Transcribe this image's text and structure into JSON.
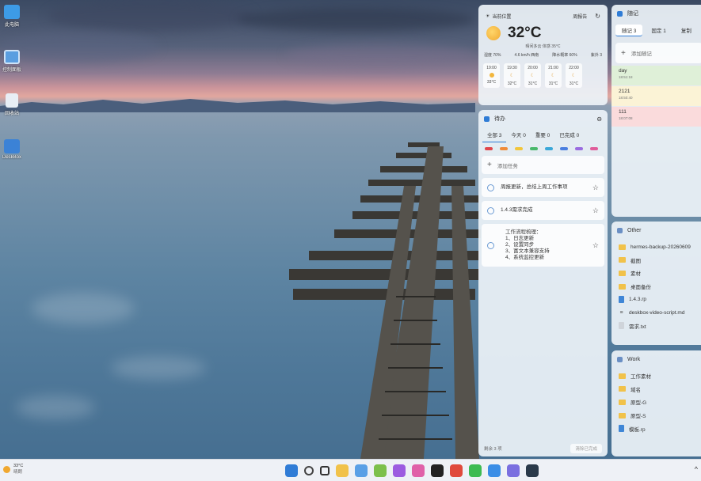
{
  "desktop": {
    "icons": [
      {
        "label": "此电脑",
        "icon": "computer-icon"
      },
      {
        "label": "控制面板",
        "icon": "control-panel-icon"
      },
      {
        "label": "回收站",
        "icon": "recycle-bin-icon"
      },
      {
        "label": "DeskBox",
        "icon": "deskbox-icon"
      }
    ]
  },
  "weather": {
    "city": "当前位置",
    "forecast_label": "周报告",
    "temperature": "32°C",
    "description": "晴间多云 体感 35°C",
    "stats": [
      "湿度 70%",
      "4.6 km/h 西南",
      "降水概率 60%",
      "紫外 3"
    ],
    "hours": [
      {
        "time": "19:00",
        "icon": "sun-icon",
        "temp": "33°C"
      },
      {
        "time": "19:30",
        "icon": "moon-icon",
        "temp": "32°C"
      },
      {
        "time": "20:00",
        "icon": "moon-icon",
        "temp": "31°C"
      },
      {
        "time": "21:00",
        "icon": "moon-icon",
        "temp": "31°C"
      },
      {
        "time": "22:00",
        "icon": "moon-icon",
        "temp": "31°C"
      }
    ]
  },
  "todo": {
    "title": "待办",
    "tabs": [
      "全部 3",
      "今天 0",
      "重要 0",
      "已完成 0"
    ],
    "color_tags": [
      "#e0464b",
      "#f08c3a",
      "#f2c63b",
      "#48b86b",
      "#3aa7d8",
      "#4b7fe0",
      "#9a6ce0",
      "#e05c9a"
    ],
    "add_label": "添加任务",
    "tasks": [
      "周报更新，总结上周工作事项",
      "1.4.3需求完成",
      "工作流程梳理：\n1、日志更新\n2、设置同步\n3、富文本兼容支持\n4、系统监控更新"
    ],
    "footer_count": "剩余 3 项",
    "footer_clear": "清除已完成"
  },
  "notes": {
    "title": "随记",
    "tabs": [
      "随记 3",
      "固定 1",
      "复制"
    ],
    "add_label": "添加随记",
    "items": [
      {
        "text": "day",
        "time": "18:51:18",
        "color": "#dff0d8"
      },
      {
        "text": "2121",
        "time": "18:50:40",
        "color": "#fbf3d6"
      },
      {
        "text": "111",
        "time": "18:07:08",
        "color": "#fadbdc"
      }
    ]
  },
  "other": {
    "title": "Other",
    "files": [
      {
        "name": "hermes-backup-20260609",
        "type": "folder"
      },
      {
        "name": "截图",
        "type": "folder"
      },
      {
        "name": "素材",
        "type": "folder"
      },
      {
        "name": "桌面备份",
        "type": "folder"
      },
      {
        "name": "1.4.3.rp",
        "type": "doc"
      },
      {
        "name": "deskbox-video-script.md",
        "type": "md"
      },
      {
        "name": "需求.txt",
        "type": "txt"
      }
    ]
  },
  "work": {
    "title": "Work",
    "files": [
      {
        "name": "工作素材",
        "type": "folder"
      },
      {
        "name": "域名",
        "type": "folder"
      },
      {
        "name": "原型-G",
        "type": "folder"
      },
      {
        "name": "原型-S",
        "type": "folder"
      },
      {
        "name": "模板.rp",
        "type": "doc"
      }
    ]
  },
  "taskbar": {
    "weather_temp": "33°C",
    "weather_desc": "晴朗",
    "apps": [
      {
        "name": "start-icon",
        "color": "#2f7cd6"
      },
      {
        "name": "search-icon",
        "color": "#444444"
      },
      {
        "name": "task-view-icon",
        "color": "#333333"
      },
      {
        "name": "file-explorer-icon",
        "color": "#f1c24a"
      },
      {
        "name": "deskbox-app-icon",
        "color": "#5aa0e6"
      },
      {
        "name": "app-green-icon",
        "color": "#7cc04b"
      },
      {
        "name": "app-purple-icon",
        "color": "#9c5ce0"
      },
      {
        "name": "app-pink-icon",
        "color": "#e061a8"
      },
      {
        "name": "app-x-icon",
        "color": "#222222"
      },
      {
        "name": "chrome-icon",
        "color": "#e04a3c"
      },
      {
        "name": "wechat-icon",
        "color": "#3dbb52"
      },
      {
        "name": "app-blue-icon",
        "color": "#3b8ee6"
      },
      {
        "name": "app-violet-icon",
        "color": "#7a6fe0"
      },
      {
        "name": "app-dark-icon",
        "color": "#2a3a4a"
      }
    ],
    "tray": "^"
  }
}
